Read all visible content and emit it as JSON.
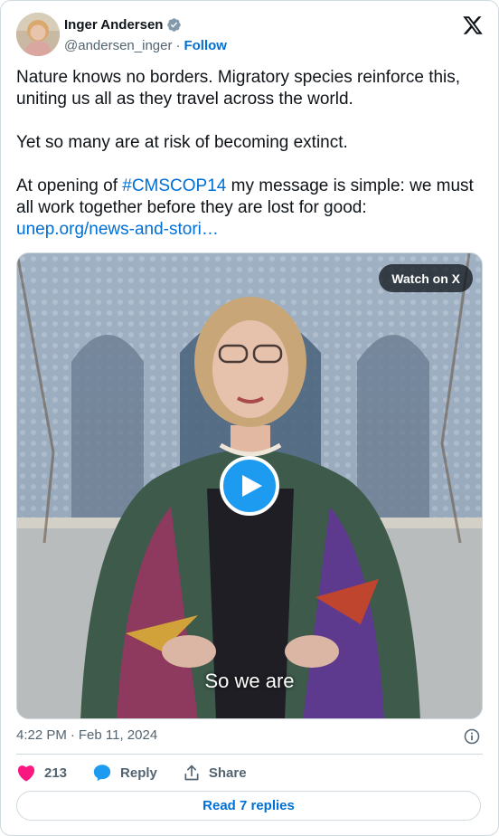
{
  "author": {
    "name": "Inger Andersen",
    "handle": "@andersen_inger",
    "separator": "·",
    "follow_label": "Follow",
    "verified_icon": "verified-badge-icon",
    "avatar_colors": [
      "#d9a7a0",
      "#b7a58f"
    ]
  },
  "platform_icon": "x-logo-icon",
  "tweet": {
    "line1": "Nature knows no borders. Migratory species reinforce this, uniting us all as they travel across the world.",
    "line2": "Yet so many are at risk of becoming extinct.",
    "line3_prefix": "At opening of ",
    "hashtag": "#CMSCOP14",
    "line3_suffix": " my message is simple: we must all work together before they are lost for good:",
    "url": "unep.org/news-and-stori…"
  },
  "media": {
    "watch_label": "Watch on X",
    "caption": "So we are",
    "play_icon": "play-icon"
  },
  "meta": {
    "time": "4:22 PM",
    "separator": "·",
    "date": "Feb 11, 2024",
    "info_icon": "info-icon"
  },
  "actions": {
    "like_count": "213",
    "reply_label": "Reply",
    "share_label": "Share"
  },
  "read_replies_label": "Read 7 replies",
  "colors": {
    "link": "#006fd6",
    "like": "#f91880",
    "verified": "#829aab",
    "play": "#1d9bf0",
    "border": "#cfd9de",
    "secondary_text": "#536471"
  }
}
